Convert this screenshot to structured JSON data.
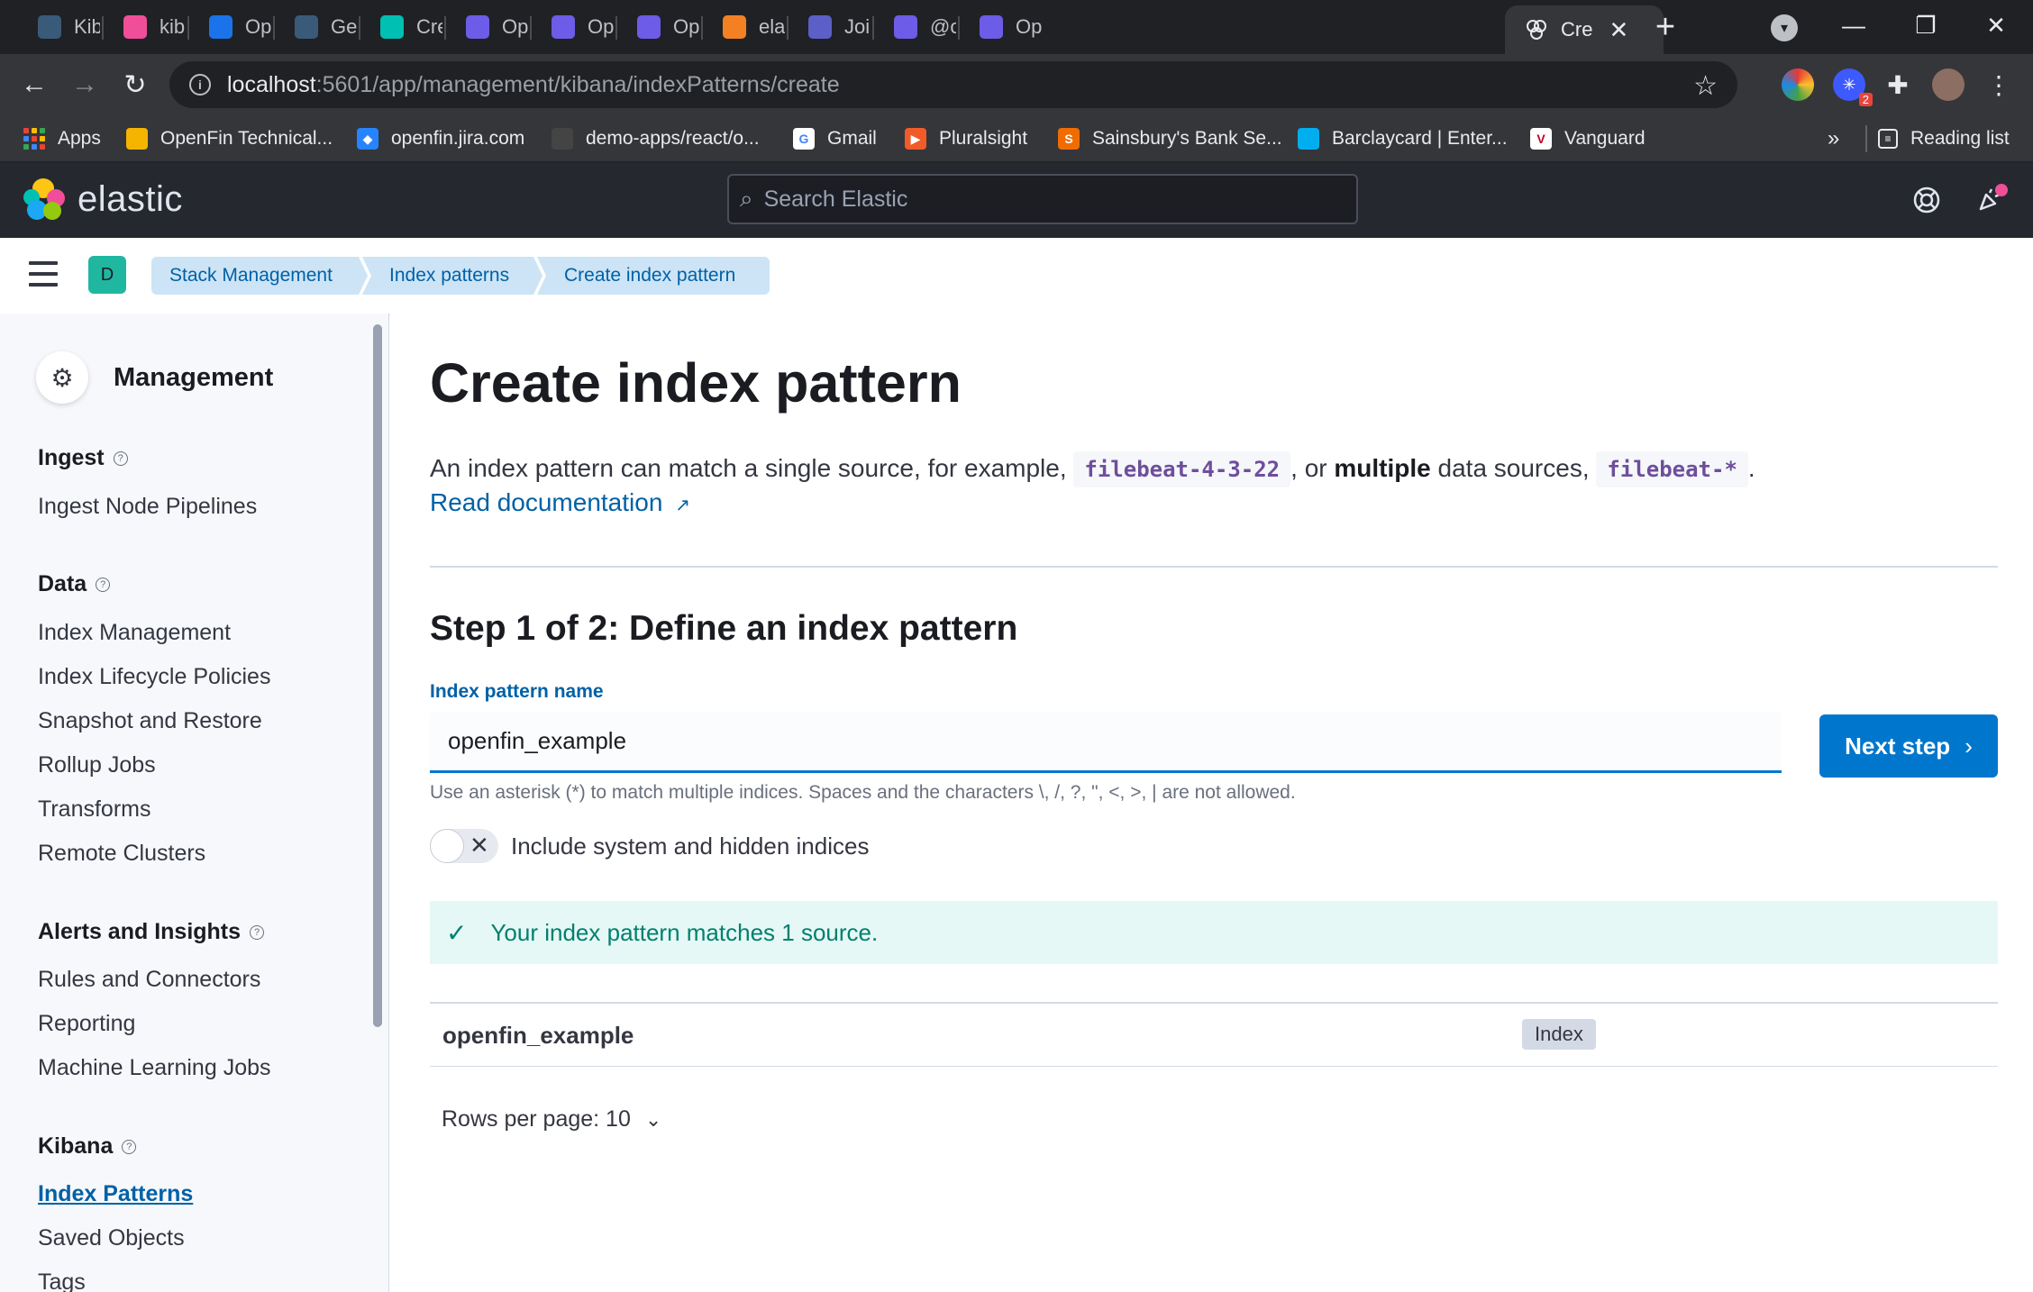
{
  "browser": {
    "tabs": [
      {
        "title": "Kibana",
        "icon": "kibana-icon",
        "color": "#3a5a7a"
      },
      {
        "title": "kibana",
        "icon": "elastic-icon",
        "color": "#f04e98"
      },
      {
        "title": "OpenFi",
        "icon": "calendar-icon",
        "color": "#1a73e8"
      },
      {
        "title": "Get Do",
        "icon": "kibana-icon",
        "color": "#3a5a7a"
      },
      {
        "title": "Create",
        "icon": "elastic-icon",
        "color": "#00bfb3"
      },
      {
        "title": "OpenFi",
        "icon": "jira-icon",
        "color": "#6c5ce7"
      },
      {
        "title": "OpenFi",
        "icon": "jira-icon",
        "color": "#6c5ce7"
      },
      {
        "title": "OpenFi",
        "icon": "jira-icon",
        "color": "#6c5ce7"
      },
      {
        "title": "elastics",
        "icon": "stackoverflow-icon",
        "color": "#f48024"
      },
      {
        "title": "Join co",
        "icon": "teams-icon",
        "color": "#5b5fc7"
      },
      {
        "title": "@open",
        "icon": "jira-icon",
        "color": "#6c5ce7"
      },
      {
        "title": "OpenFi",
        "icon": "jira-icon",
        "color": "#6c5ce7"
      }
    ],
    "active_tab": {
      "title": "Cre",
      "icon": "elastic-icon"
    },
    "url_host": "localhost",
    "url_rest": ":5601/app/management/kibana/indexPatterns/create",
    "ext_badge": "2",
    "bookmarks": [
      {
        "label": "Apps",
        "icon": "apps-grid-icon"
      },
      {
        "label": "OpenFin Technical...",
        "icon": "folder-icon",
        "color": "#f4b400",
        "glyph": ""
      },
      {
        "label": "openfin.jira.com",
        "icon": "jira-icon",
        "color": "#2684ff",
        "glyph": "◆"
      },
      {
        "label": "demo-apps/react/o...",
        "icon": "github-icon",
        "color": "#444444",
        "glyph": ""
      },
      {
        "label": "Gmail",
        "icon": "google-icon",
        "color": "#ffffff",
        "glyph": "G"
      },
      {
        "label": "Pluralsight",
        "icon": "pluralsight-icon",
        "color": "#f15b2a",
        "glyph": "▶"
      },
      {
        "label": "Sainsbury's Bank Se...",
        "icon": "sainsburys-icon",
        "color": "#f06c00",
        "glyph": "S"
      },
      {
        "label": "Barclaycard | Enter...",
        "icon": "barclaycard-icon",
        "color": "#00aeef",
        "glyph": ""
      },
      {
        "label": "Vanguard",
        "icon": "vanguard-icon",
        "color": "#ffffff",
        "glyph": "V"
      }
    ],
    "bookmarks_overflow": "»",
    "reading_list": "Reading list"
  },
  "kibana": {
    "brand": "elastic",
    "search_placeholder": "Search Elastic",
    "space_initial": "D",
    "breadcrumbs": [
      "Stack Management",
      "Index patterns",
      "Create index pattern"
    ]
  },
  "sidebar": {
    "title": "Management",
    "sections": {
      "ingest": {
        "title": "Ingest",
        "items": [
          "Ingest Node Pipelines"
        ]
      },
      "data": {
        "title": "Data",
        "items": [
          "Index Management",
          "Index Lifecycle Policies",
          "Snapshot and Restore",
          "Rollup Jobs",
          "Transforms",
          "Remote Clusters"
        ]
      },
      "alerts": {
        "title": "Alerts and Insights",
        "items": [
          "Rules and Connectors",
          "Reporting",
          "Machine Learning Jobs"
        ]
      },
      "kibana": {
        "title": "Kibana",
        "items": [
          "Index Patterns",
          "Saved Objects",
          "Tags"
        ]
      }
    }
  },
  "main": {
    "title": "Create index pattern",
    "intro_1": "An index pattern can match a single source, for example,",
    "example_single": "filebeat-4-3-22",
    "intro_2": ", or",
    "intro_bold": "multiple",
    "intro_3": "data sources,",
    "example_multi": "filebeat-*",
    "intro_4": ".",
    "doc_link": "Read documentation",
    "step_title": "Step 1 of 2: Define an index pattern",
    "field_label": "Index pattern name",
    "field_value": "openfin_example",
    "help_text": "Use an asterisk (*) to match multiple indices. Spaces and the characters \\, /, ?, \", <, >, | are not allowed.",
    "next_button": "Next step",
    "toggle_label": "Include system and hidden indices",
    "toggle_on": false,
    "match_message": "Your index pattern matches 1 source.",
    "results": [
      {
        "name": "openfin_example",
        "type": "Index"
      }
    ],
    "rows_per_page": "Rows per page: 10"
  },
  "colors": {
    "accent": "#0077cc",
    "success": "#00806f",
    "breadcrumb_bg": "#cce4f5",
    "header_bg": "#25282f"
  }
}
